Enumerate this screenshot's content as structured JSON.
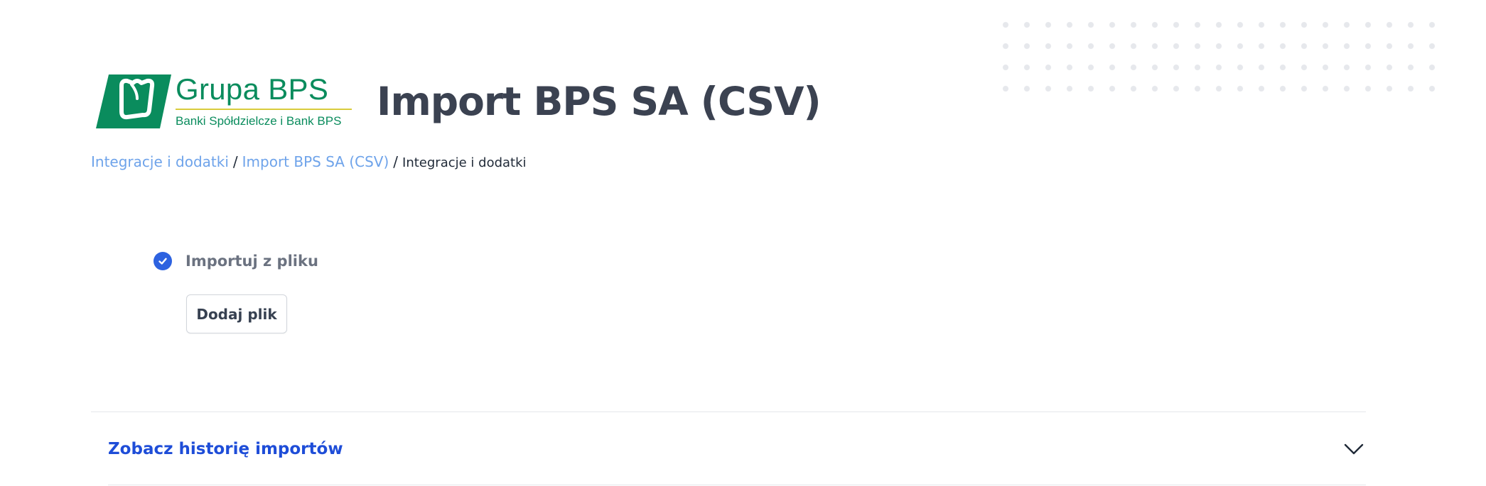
{
  "header": {
    "logo": {
      "title": "Grupa BPS",
      "subtitle": "Banki Spółdzielcze i Bank BPS"
    },
    "page_title": "Import BPS SA (CSV)"
  },
  "breadcrumb": {
    "items": [
      {
        "label": "Integracje i dodatki"
      },
      {
        "label": "Import BPS SA (CSV)"
      }
    ],
    "separator": "/",
    "current": "Integracje i dodatki"
  },
  "import": {
    "option_label": "Importuj z pliku",
    "add_file_label": "Dodaj plik"
  },
  "history": {
    "title": "Zobacz historię importów"
  },
  "colors": {
    "brand_green": "#0a8c5d",
    "accent_blue": "#2d62e0",
    "link_blue": "#6ea3ea",
    "heading": "#3b4251"
  },
  "icons": {
    "check": "check-circle-icon",
    "chevron": "chevron-down-icon"
  }
}
